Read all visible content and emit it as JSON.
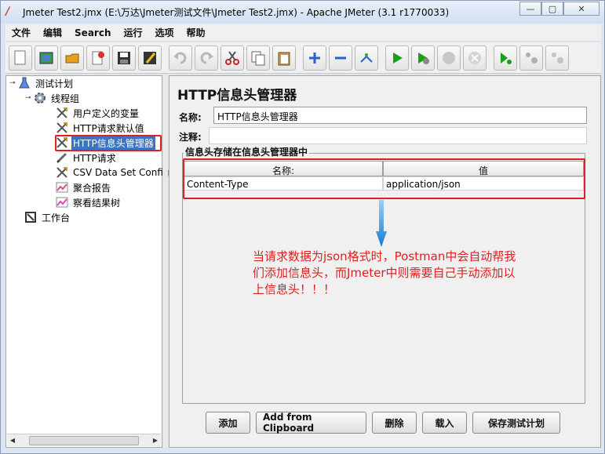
{
  "window": {
    "title": "Jmeter Test2.jmx (E:\\万达\\Jmeter测试文件\\Jmeter Test2.jmx) - Apache JMeter (3.1 r1770033)",
    "minimize": "—",
    "maximize": "▢",
    "close": "✕"
  },
  "menu": [
    "文件",
    "编辑",
    "Search",
    "运行",
    "选项",
    "帮助"
  ],
  "toolbar_icons": [
    "new-icon",
    "templates-icon",
    "open-icon",
    "close-file-icon",
    "save-icon",
    "save-as-icon",
    "undo-icon",
    "redo-icon",
    "cut-icon",
    "copy-icon",
    "paste-icon",
    "expand-icon",
    "collapse-icon",
    "toggle-icon",
    "start-icon",
    "start-no-pause-icon",
    "stop-icon",
    "shutdown-icon",
    "remote-start-icon",
    "remote-stop-icon",
    "remote-shutdown-icon"
  ],
  "tree": {
    "test_plan": "测试计划",
    "thread_group": "线程组",
    "user_vars": "用户定义的变量",
    "http_defaults": "HTTP请求默认值",
    "header_manager": "HTTP信息头管理器",
    "http_request": "HTTP请求",
    "csv": "CSV Data Set Config",
    "aggregate": "聚合报告",
    "results_tree": "察看结果树",
    "workbench": "工作台"
  },
  "panel": {
    "title": "HTTP信息头管理器",
    "name_label": "名称:",
    "name_value": "HTTP信息头管理器",
    "comment_label": "注释:",
    "comment_value": "",
    "group_title": "信息头存储在信息头管理器中",
    "table": {
      "headers": [
        "名称:",
        "值"
      ],
      "rows": [
        [
          "Content-Type",
          "application/json"
        ]
      ]
    },
    "annotation": "当请求数据为json格式时，Postman中会自动帮我们添加信息头，而Jmeter中则需要自己手动添加以上信息头！！！",
    "buttons": {
      "add": "添加",
      "add_clipboard": "Add from Clipboard",
      "delete": "删除",
      "load": "载入",
      "save_plan": "保存测试计划"
    }
  },
  "colors": {
    "highlight_red": "#e02020",
    "selection_blue": "#3a75c4",
    "arrow_blue": "#2a8ad8"
  }
}
